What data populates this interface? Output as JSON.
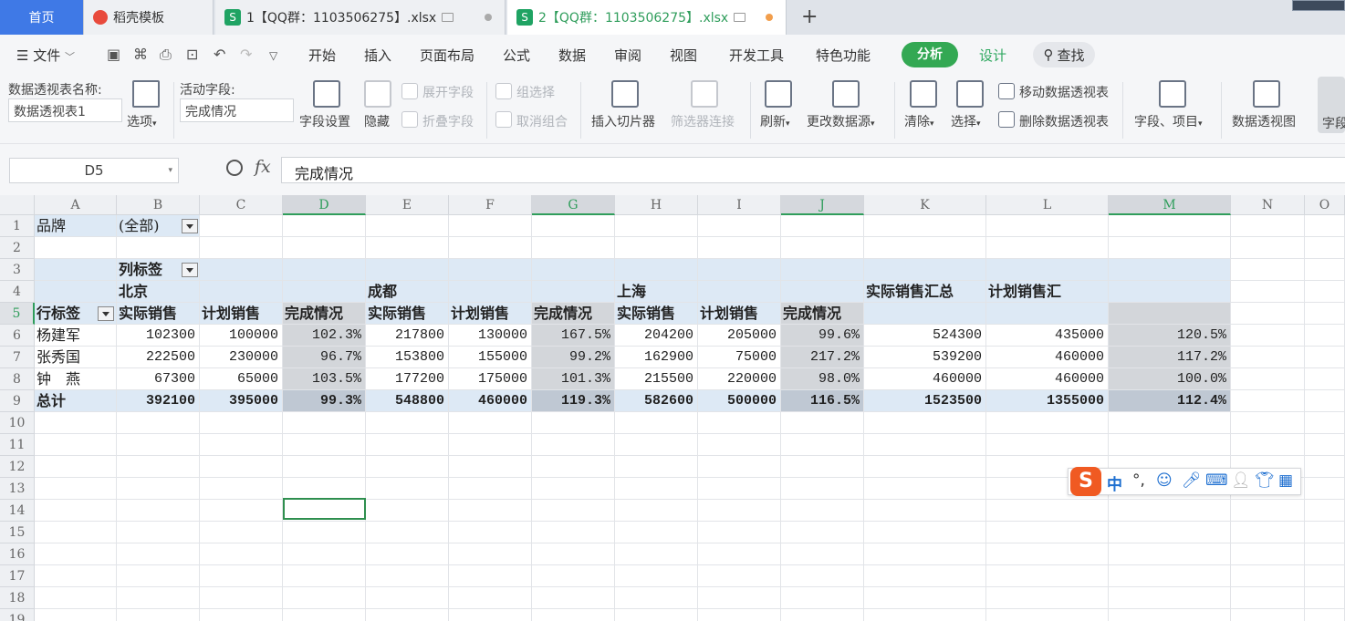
{
  "tabs": {
    "home": "首页",
    "template": "稻壳模板",
    "file1": "1【QQ群：1103506275】.xlsx",
    "file2": "2【QQ群：1103506275】.xlsx",
    "add": "+"
  },
  "menu": {
    "file": "文件",
    "items": [
      "开始",
      "插入",
      "页面布局",
      "公式",
      "数据",
      "审阅",
      "视图",
      "开发工具",
      "特色功能"
    ],
    "analysis": "分析",
    "design": "设计",
    "find": "查找"
  },
  "ribbon": {
    "pivot_name_label": "数据透视表名称:",
    "pivot_name_value": "数据透视表1",
    "options": "选项",
    "active_field_label": "活动字段:",
    "active_field_value": "完成情况",
    "field_settings": "字段设置",
    "hide": "隐藏",
    "expand_field": "展开字段",
    "collapse_field": "折叠字段",
    "group_selection": "组选择",
    "ungroup": "取消组合",
    "insert_slicer": "插入切片器",
    "filter_connections": "筛选器连接",
    "refresh": "刷新",
    "change_source": "更改数据源",
    "clear": "清除",
    "select": "选择",
    "move_pivot": "移动数据透视表",
    "delete_pivot": "删除数据透视表",
    "fields_items": "字段、项目",
    "pivot_chart": "数据透视图",
    "field_list_partial": "字段"
  },
  "formula_bar": {
    "name_box": "D5",
    "fx": "fx",
    "content": "完成情况"
  },
  "columns": [
    "A",
    "B",
    "C",
    "D",
    "E",
    "F",
    "G",
    "H",
    "I",
    "J",
    "K",
    "L",
    "M",
    "N",
    "O"
  ],
  "rows": [
    "1",
    "2",
    "3",
    "4",
    "5",
    "6",
    "7",
    "8",
    "9",
    "10",
    "11",
    "12",
    "13",
    "14",
    "15",
    "16",
    "17",
    "18",
    "19"
  ],
  "pivot": {
    "filter_label": "品牌",
    "filter_value": "(全部)",
    "col_labels": "列标签",
    "cities": [
      "北京",
      "成都",
      "上海"
    ],
    "total_actual_header": "实际销售汇总",
    "total_plan_header": "计划销售汇",
    "row_labels": "行标签",
    "measures": [
      "实际销售",
      "计划销售",
      "完成情况"
    ],
    "names": [
      "杨建军",
      "张秀国",
      "钟　燕"
    ],
    "grand_total": "总计",
    "data": [
      [
        "102300",
        "100000",
        "102.3%",
        "217800",
        "130000",
        "167.5%",
        "204200",
        "205000",
        "99.6%",
        "524300",
        "435000",
        "120.5%"
      ],
      [
        "222500",
        "230000",
        "96.7%",
        "153800",
        "155000",
        "99.2%",
        "162900",
        "75000",
        "217.2%",
        "539200",
        "460000",
        "117.2%"
      ],
      [
        "67300",
        "65000",
        "103.5%",
        "177200",
        "175000",
        "101.3%",
        "215500",
        "220000",
        "98.0%",
        "460000",
        "460000",
        "100.0%"
      ]
    ],
    "totals": [
      "392100",
      "395000",
      "99.3%",
      "548800",
      "460000",
      "119.3%",
      "582600",
      "500000",
      "116.5%",
      "1523500",
      "1355000",
      "112.4%"
    ]
  },
  "ime": {
    "logo": "S",
    "lang": "中",
    "punct": "°,"
  }
}
